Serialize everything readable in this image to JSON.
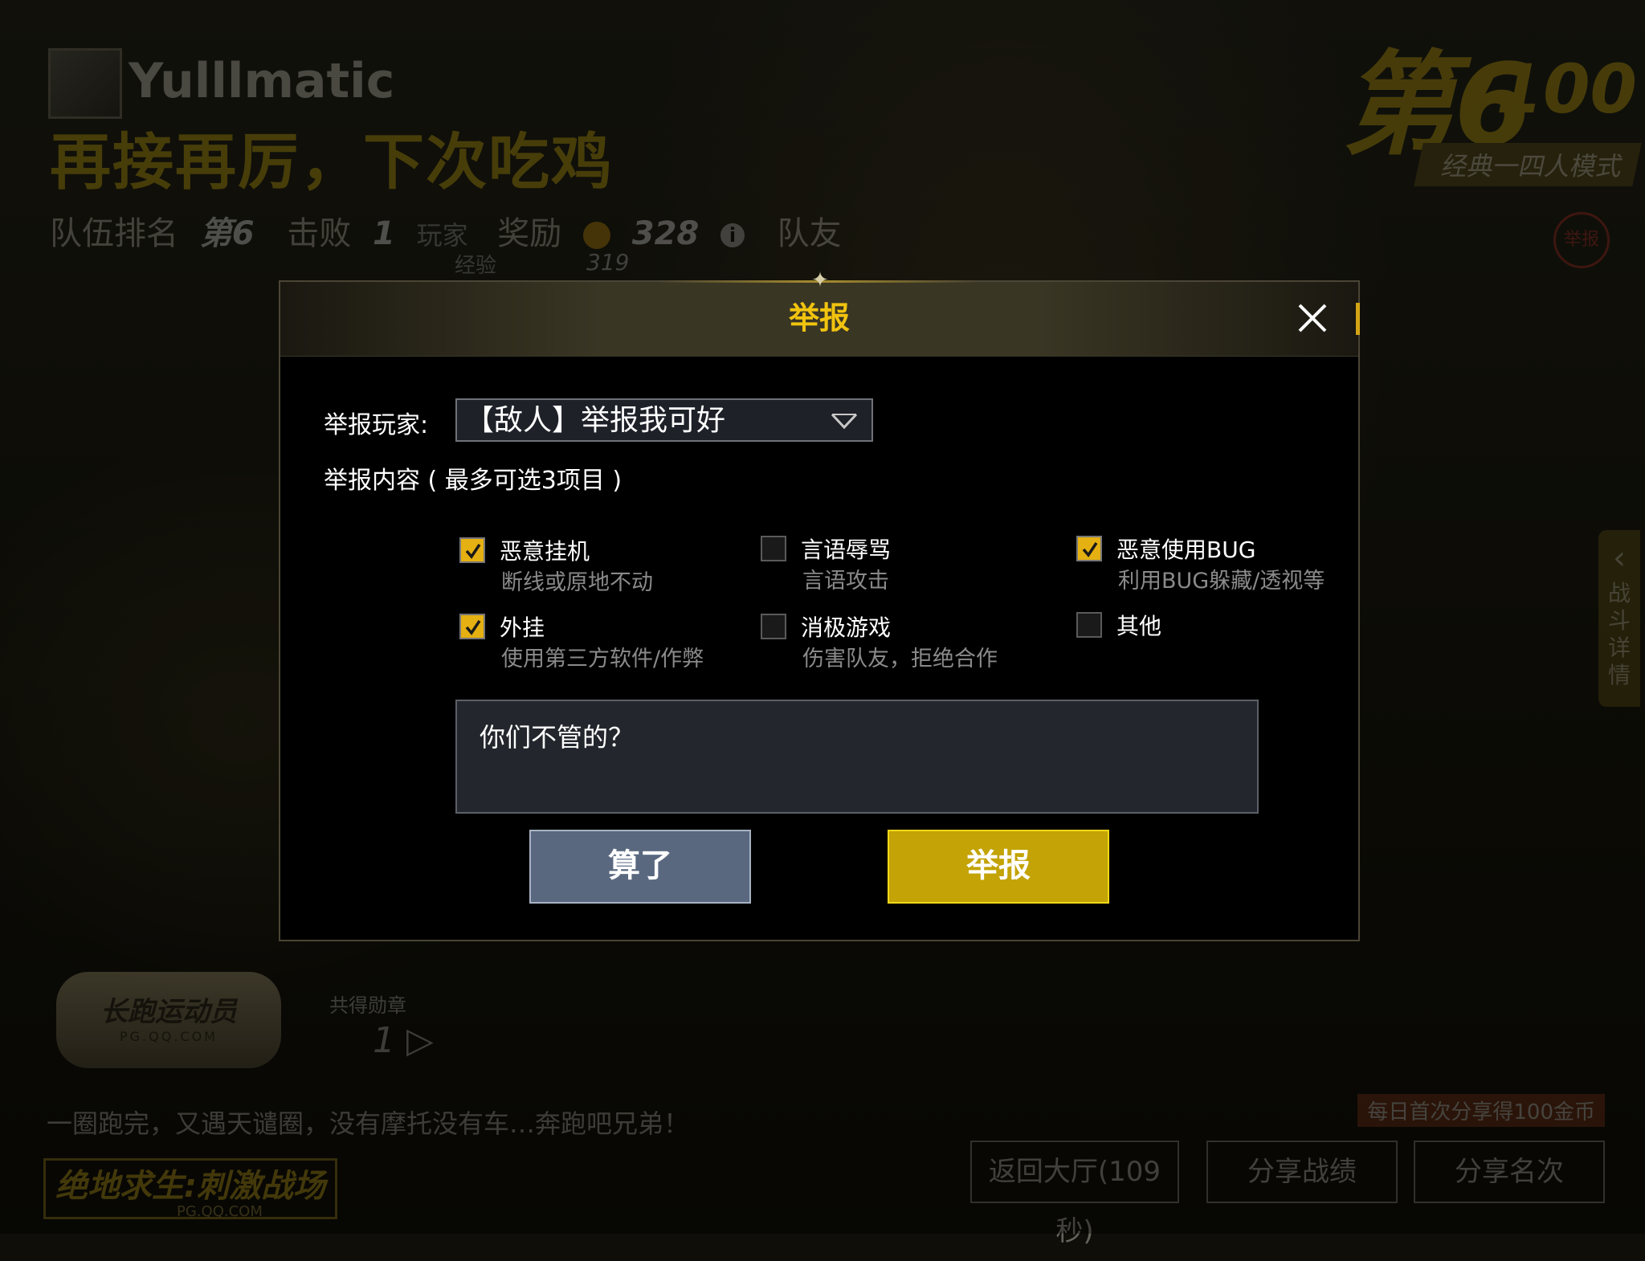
{
  "background": {
    "player_name": "Yulllmatic",
    "slogan": "再接再厉，下次吃鸡",
    "rank_big": "第6",
    "rank_total": "/100",
    "mode": "经典一四人模式",
    "stats": {
      "team_rank_label": "队伍排名",
      "team_rank_value": "第6",
      "kills_label": "击败",
      "kills_value": "1",
      "kills_unit": "玩家",
      "reward_label": "奖励",
      "reward_value": "328",
      "teammates_label": "队友",
      "exp_label": "经验",
      "exp_value": "319"
    },
    "report_circle": "举报",
    "side_tab_label": "战斗详情",
    "medal_title": "长跑运动员",
    "medal_sub": "PG.QQ.COM",
    "medal_count_label": "共得勋章",
    "medal_count": "1",
    "quote": "一圈跑完，又遇天谴圈，没有摩托没有车…奔跑吧兄弟！",
    "logo_text": "绝地求生:刺激战场",
    "logo_url": "PG.QQ.COM",
    "share_tip": "每日首次分享得100金币",
    "buttons": {
      "back_lobby": "返回大厅(109秒)",
      "share_record": "分享战绩",
      "share_rank": "分享名次"
    }
  },
  "modal": {
    "title": "举报",
    "player_label": "举报玩家:",
    "selected_player": "【敌人】举报我可好",
    "content_label": "举报内容 ( 最多可选3项目 )",
    "options": [
      {
        "title": "恶意挂机",
        "desc": "断线或原地不动",
        "checked": true
      },
      {
        "title": "言语辱骂",
        "desc": "言语攻击",
        "checked": false
      },
      {
        "title": "恶意使用BUG",
        "desc": "利用BUG躲藏/透视等",
        "checked": true
      },
      {
        "title": "外挂",
        "desc": "使用第三方软件/作弊",
        "checked": true
      },
      {
        "title": "消极游戏",
        "desc": "伤害队友，拒绝合作",
        "checked": false
      },
      {
        "title": "其他",
        "desc": "",
        "checked": false
      }
    ],
    "text_value": "你们不管的？",
    "cancel_label": "算了",
    "submit_label": "举报"
  },
  "colors": {
    "accent_yellow": "#f1c40f",
    "submit_bg": "#c3a305",
    "cancel_bg": "#59687f",
    "checkbox_checked": "#e5b011"
  }
}
